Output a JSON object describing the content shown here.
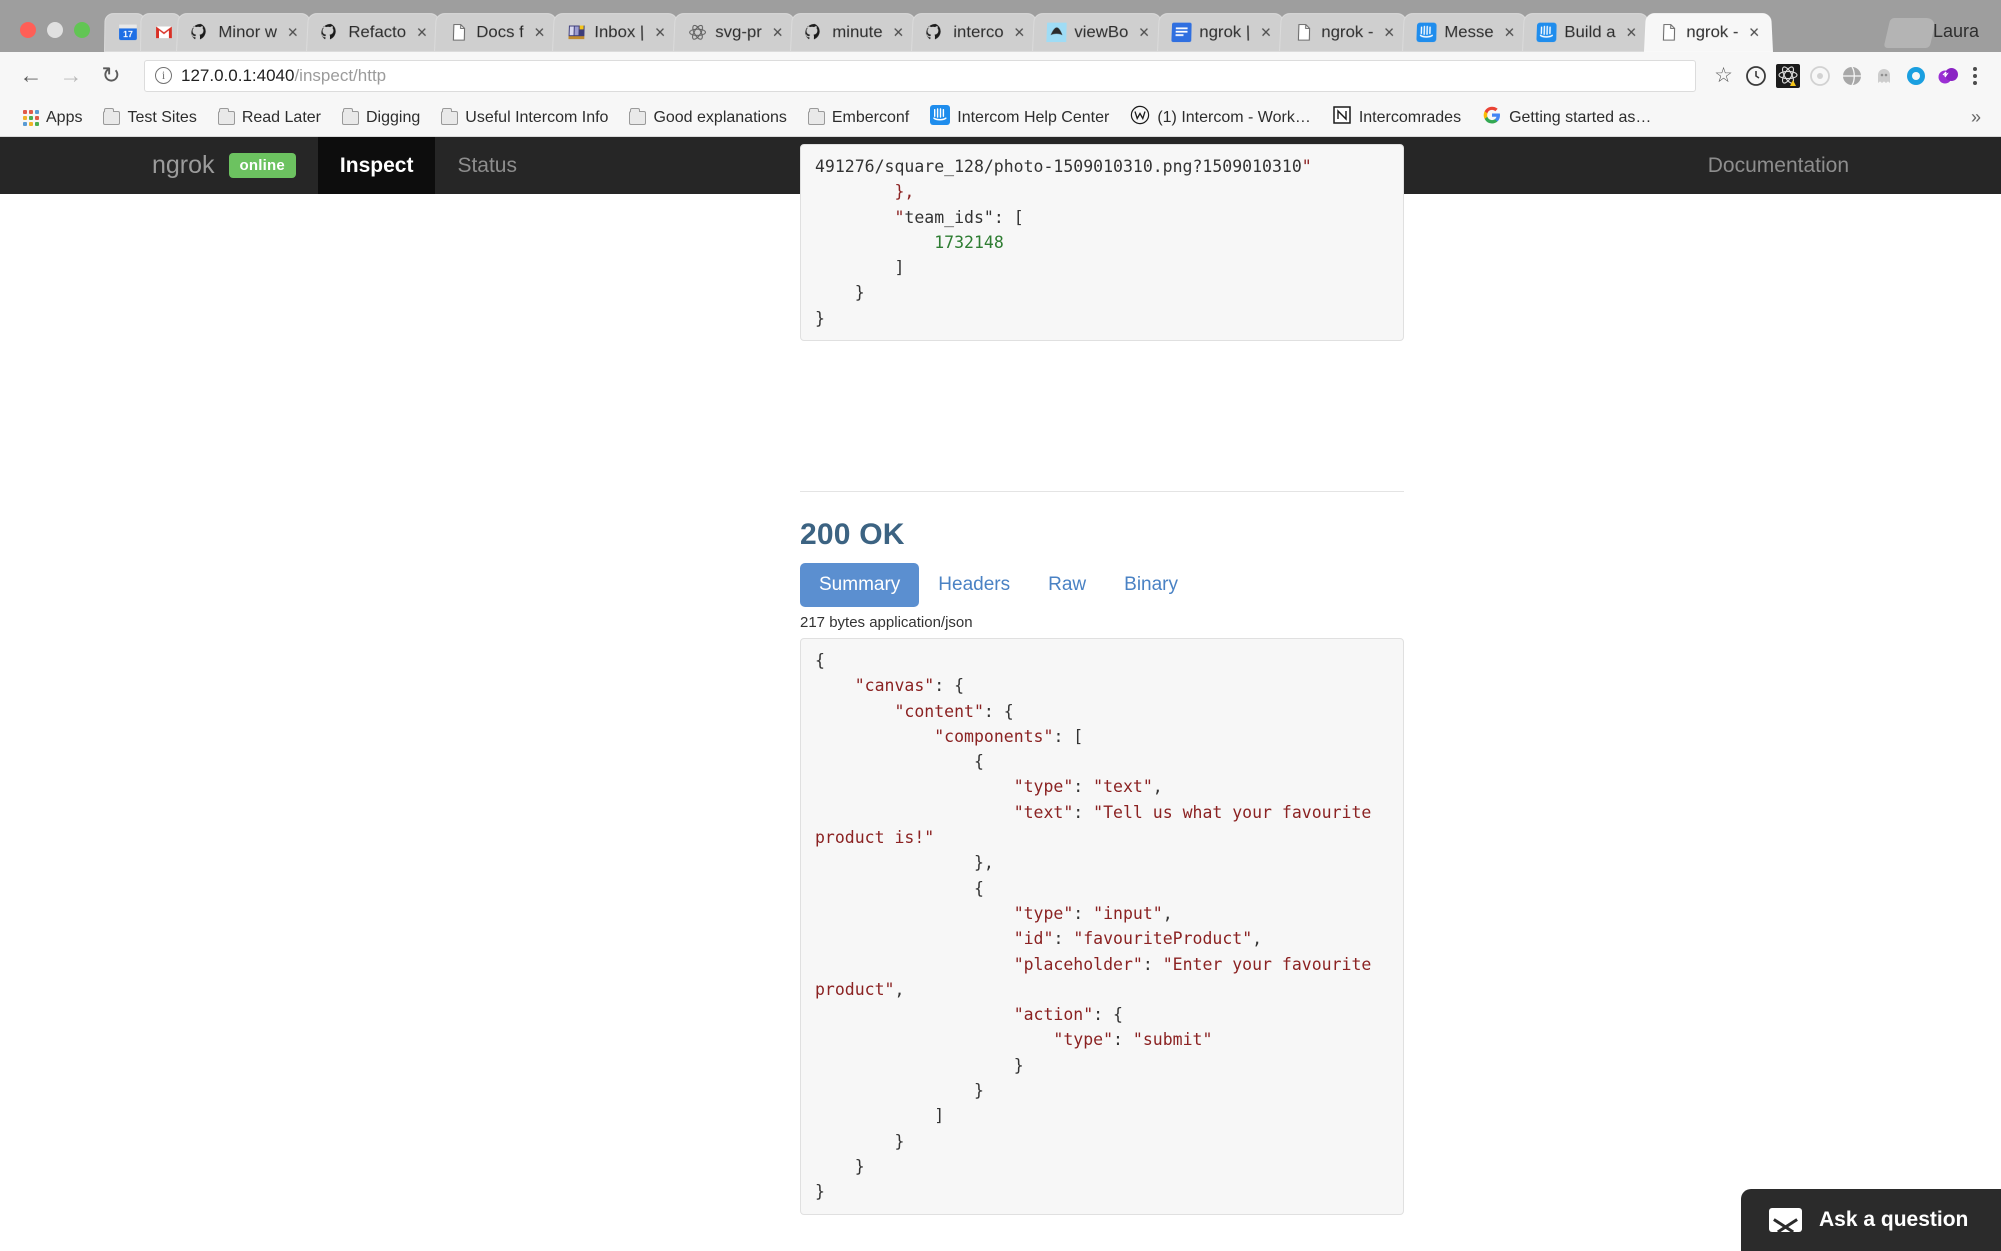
{
  "browser": {
    "profile_name": "Laura",
    "tabs": [
      {
        "title": "",
        "favicon": "calendar-icon",
        "closable": false,
        "active": false
      },
      {
        "title": "",
        "favicon": "gmail-icon",
        "closable": false,
        "active": false
      },
      {
        "title": "Minor w",
        "favicon": "github-icon",
        "closable": true,
        "active": false
      },
      {
        "title": "Refacto",
        "favicon": "github-icon",
        "closable": true,
        "active": false
      },
      {
        "title": "Docs f",
        "favicon": "document-icon",
        "closable": true,
        "active": false
      },
      {
        "title": "Inbox |",
        "favicon": "inbox-icon",
        "closable": true,
        "active": false
      },
      {
        "title": "svg-pr",
        "favicon": "atom-icon",
        "closable": true,
        "active": false
      },
      {
        "title": "minute",
        "favicon": "github-icon",
        "closable": true,
        "active": false
      },
      {
        "title": "interco",
        "favicon": "github-icon",
        "closable": true,
        "active": false
      },
      {
        "title": "viewBo",
        "favicon": "sketch-icon",
        "closable": true,
        "active": false
      },
      {
        "title": "ngrok |",
        "favicon": "bluedoc-icon",
        "closable": true,
        "active": false
      },
      {
        "title": "ngrok -",
        "favicon": "document-icon",
        "closable": true,
        "active": false
      },
      {
        "title": "Messe",
        "favicon": "intercom-icon",
        "closable": true,
        "active": false
      },
      {
        "title": "Build a",
        "favicon": "intercom-icon",
        "closable": true,
        "active": false
      },
      {
        "title": "ngrok -",
        "favicon": "document-icon",
        "closable": true,
        "active": true
      }
    ],
    "nav": {
      "back_icon": "back-arrow-icon",
      "forward_icon": "forward-arrow-icon",
      "reload_icon": "reload-icon"
    },
    "omnibox": {
      "info_icon": "site-info-icon",
      "host": "127.0.0.1:4040",
      "path": "/inspect/http",
      "star_icon": "bookmark-star-icon"
    },
    "extensions": [
      "clock-extension-icon",
      "react-devtools-icon",
      "ember-inspector-icon",
      "globe-extension-icon",
      "ghost-extension-icon",
      "circle-extension-icon",
      "purple-extension-icon"
    ],
    "menu_icon": "chrome-menu-icon",
    "bookmarks": [
      {
        "label": "Apps",
        "icon": "apps-grid-icon"
      },
      {
        "label": "Test Sites",
        "icon": "folder-icon"
      },
      {
        "label": "Read Later",
        "icon": "folder-icon"
      },
      {
        "label": "Digging",
        "icon": "folder-icon"
      },
      {
        "label": "Useful Intercom Info",
        "icon": "folder-icon"
      },
      {
        "label": "Good explanations",
        "icon": "folder-icon"
      },
      {
        "label": "Emberconf",
        "icon": "folder-icon"
      },
      {
        "label": "Intercom Help Center",
        "icon": "intercom-icon"
      },
      {
        "label": "(1) Intercom - Work…",
        "icon": "workflowy-icon"
      },
      {
        "label": "Intercomrades",
        "icon": "notion-icon"
      },
      {
        "label": "Getting started as…",
        "icon": "google-icon"
      }
    ],
    "bookmarks_overflow_icon": "chevron-double-right-icon"
  },
  "ngrok": {
    "brand": "ngrok",
    "status_badge": "online",
    "nav_items": [
      {
        "label": "Inspect",
        "active": true
      },
      {
        "label": "Status",
        "active": false
      }
    ],
    "documentation_label": "Documentation",
    "colors": {
      "nav_background": "#262626",
      "online_badge": "#6cc260",
      "tab_active": "#5b8fd0",
      "status_title": "#3c6382"
    }
  },
  "request_tail": {
    "code": "491276/square_128/photo-1509010310.png?1509010310\"\n        },\n        \"team_ids\": [\n            1732148\n        ]\n    }\n}",
    "team_id": "1732148"
  },
  "response": {
    "status": "200 OK",
    "tabs": [
      {
        "label": "Summary",
        "active": true
      },
      {
        "label": "Headers",
        "active": false
      },
      {
        "label": "Raw",
        "active": false
      },
      {
        "label": "Binary",
        "active": false
      }
    ],
    "meta": "217 bytes application/json",
    "body": "{\n    \"canvas\": {\n        \"content\": {\n            \"components\": [\n                {\n                    \"type\": \"text\",\n                    \"text\": \"Tell us what your favourite product is!\"\n                },\n                {\n                    \"type\": \"input\",\n                    \"id\": \"favouriteProduct\",\n                    \"placeholder\": \"Enter your favourite product\",\n                    \"action\": {\n                        \"type\": \"submit\"\n                    }\n                }\n            ]\n        }\n    }\n}"
  },
  "intercom_launcher": {
    "label": "Ask a question",
    "icon": "envelope-icon"
  }
}
